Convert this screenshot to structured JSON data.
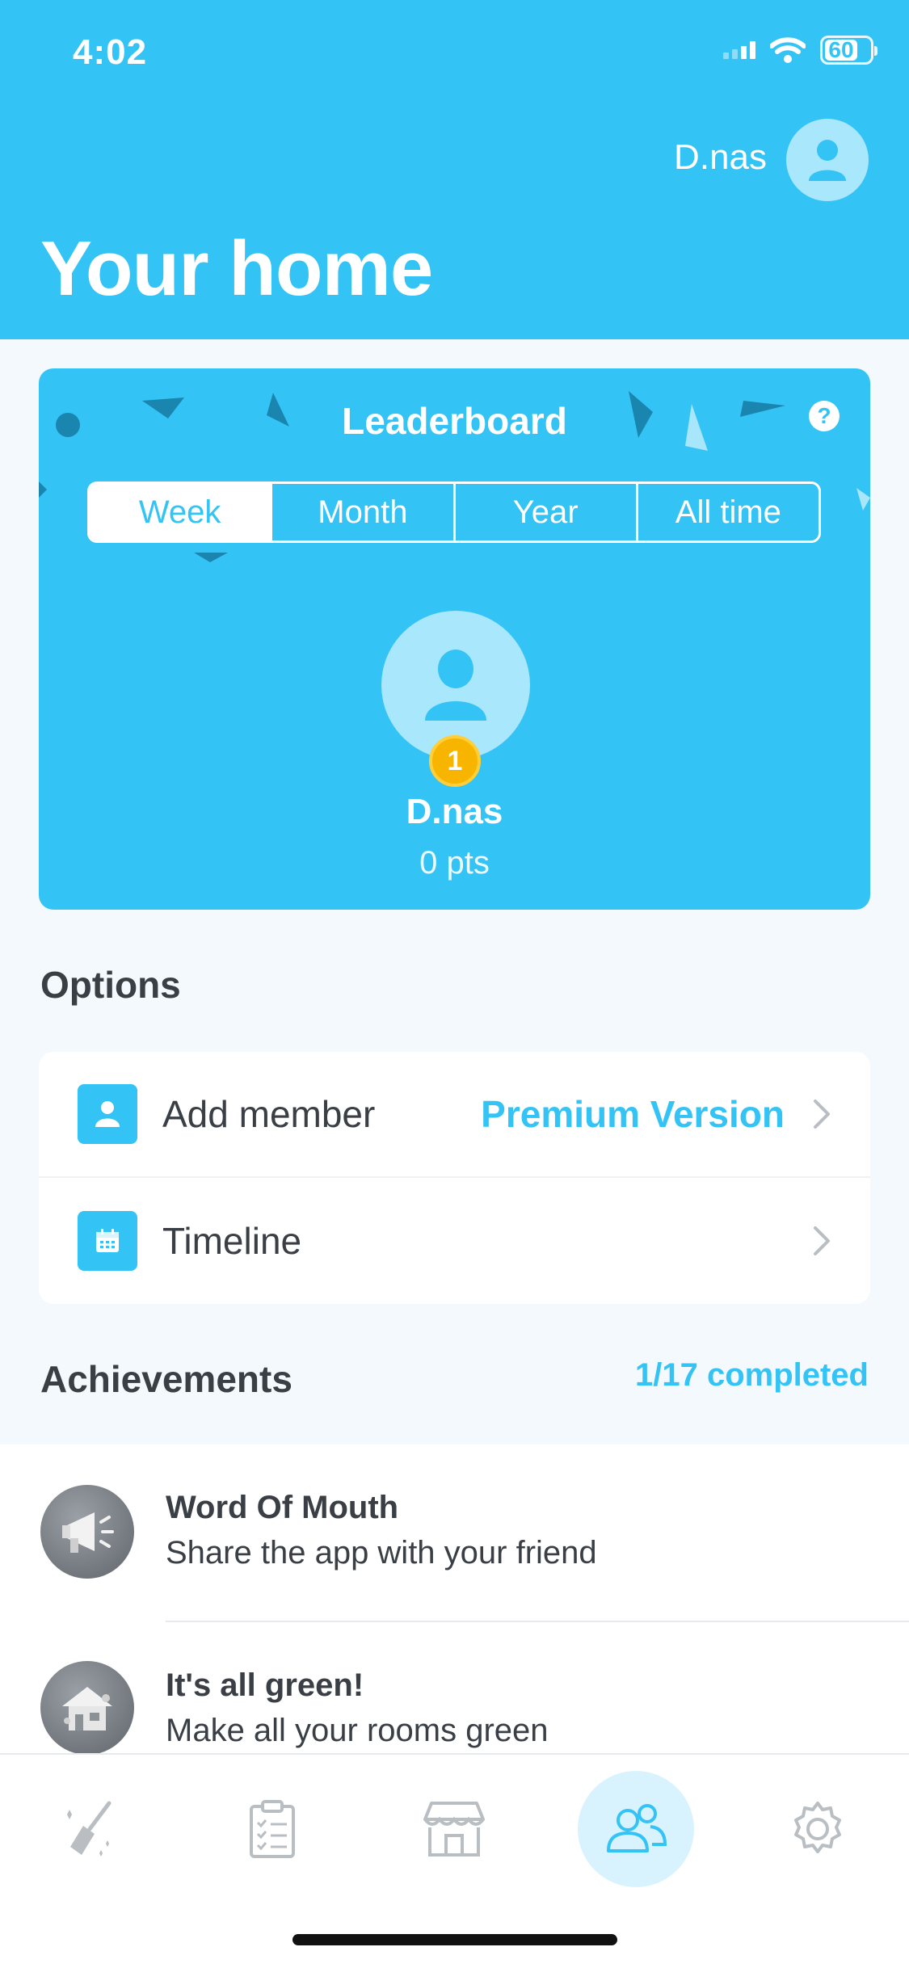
{
  "status_bar": {
    "time": "4:02",
    "battery": "60"
  },
  "header": {
    "user_name": "D.nas",
    "title": "Your home"
  },
  "leaderboard": {
    "title": "Leaderboard",
    "help_symbol": "?",
    "periods": [
      "Week",
      "Month",
      "Year",
      "All time"
    ],
    "selected_period": "Week",
    "leader": {
      "rank": "1",
      "name": "D.nas",
      "points": "0 pts"
    }
  },
  "options": {
    "title": "Options",
    "items": [
      {
        "label": "Add member",
        "extra": "Premium Version",
        "icon": "person-icon"
      },
      {
        "label": "Timeline",
        "icon": "calendar-icon"
      }
    ]
  },
  "achievements": {
    "title": "Achievements",
    "count": "1/17 completed",
    "items": [
      {
        "title": "Word Of Mouth",
        "desc": "Share the app with your friend",
        "icon": "megaphone-icon"
      },
      {
        "title": "It's all green!",
        "desc": "Make all your rooms green",
        "icon": "house-icon"
      }
    ]
  },
  "tabbar": {
    "tabs": [
      "broom-icon",
      "checklist-icon",
      "store-icon",
      "members-icon",
      "gear-icon"
    ],
    "active": "members-icon"
  },
  "colors": {
    "accent": "#34c3f5",
    "avatar_bg": "#a9e7fd",
    "medal": "#f7b500",
    "text": "#3a3f45"
  }
}
